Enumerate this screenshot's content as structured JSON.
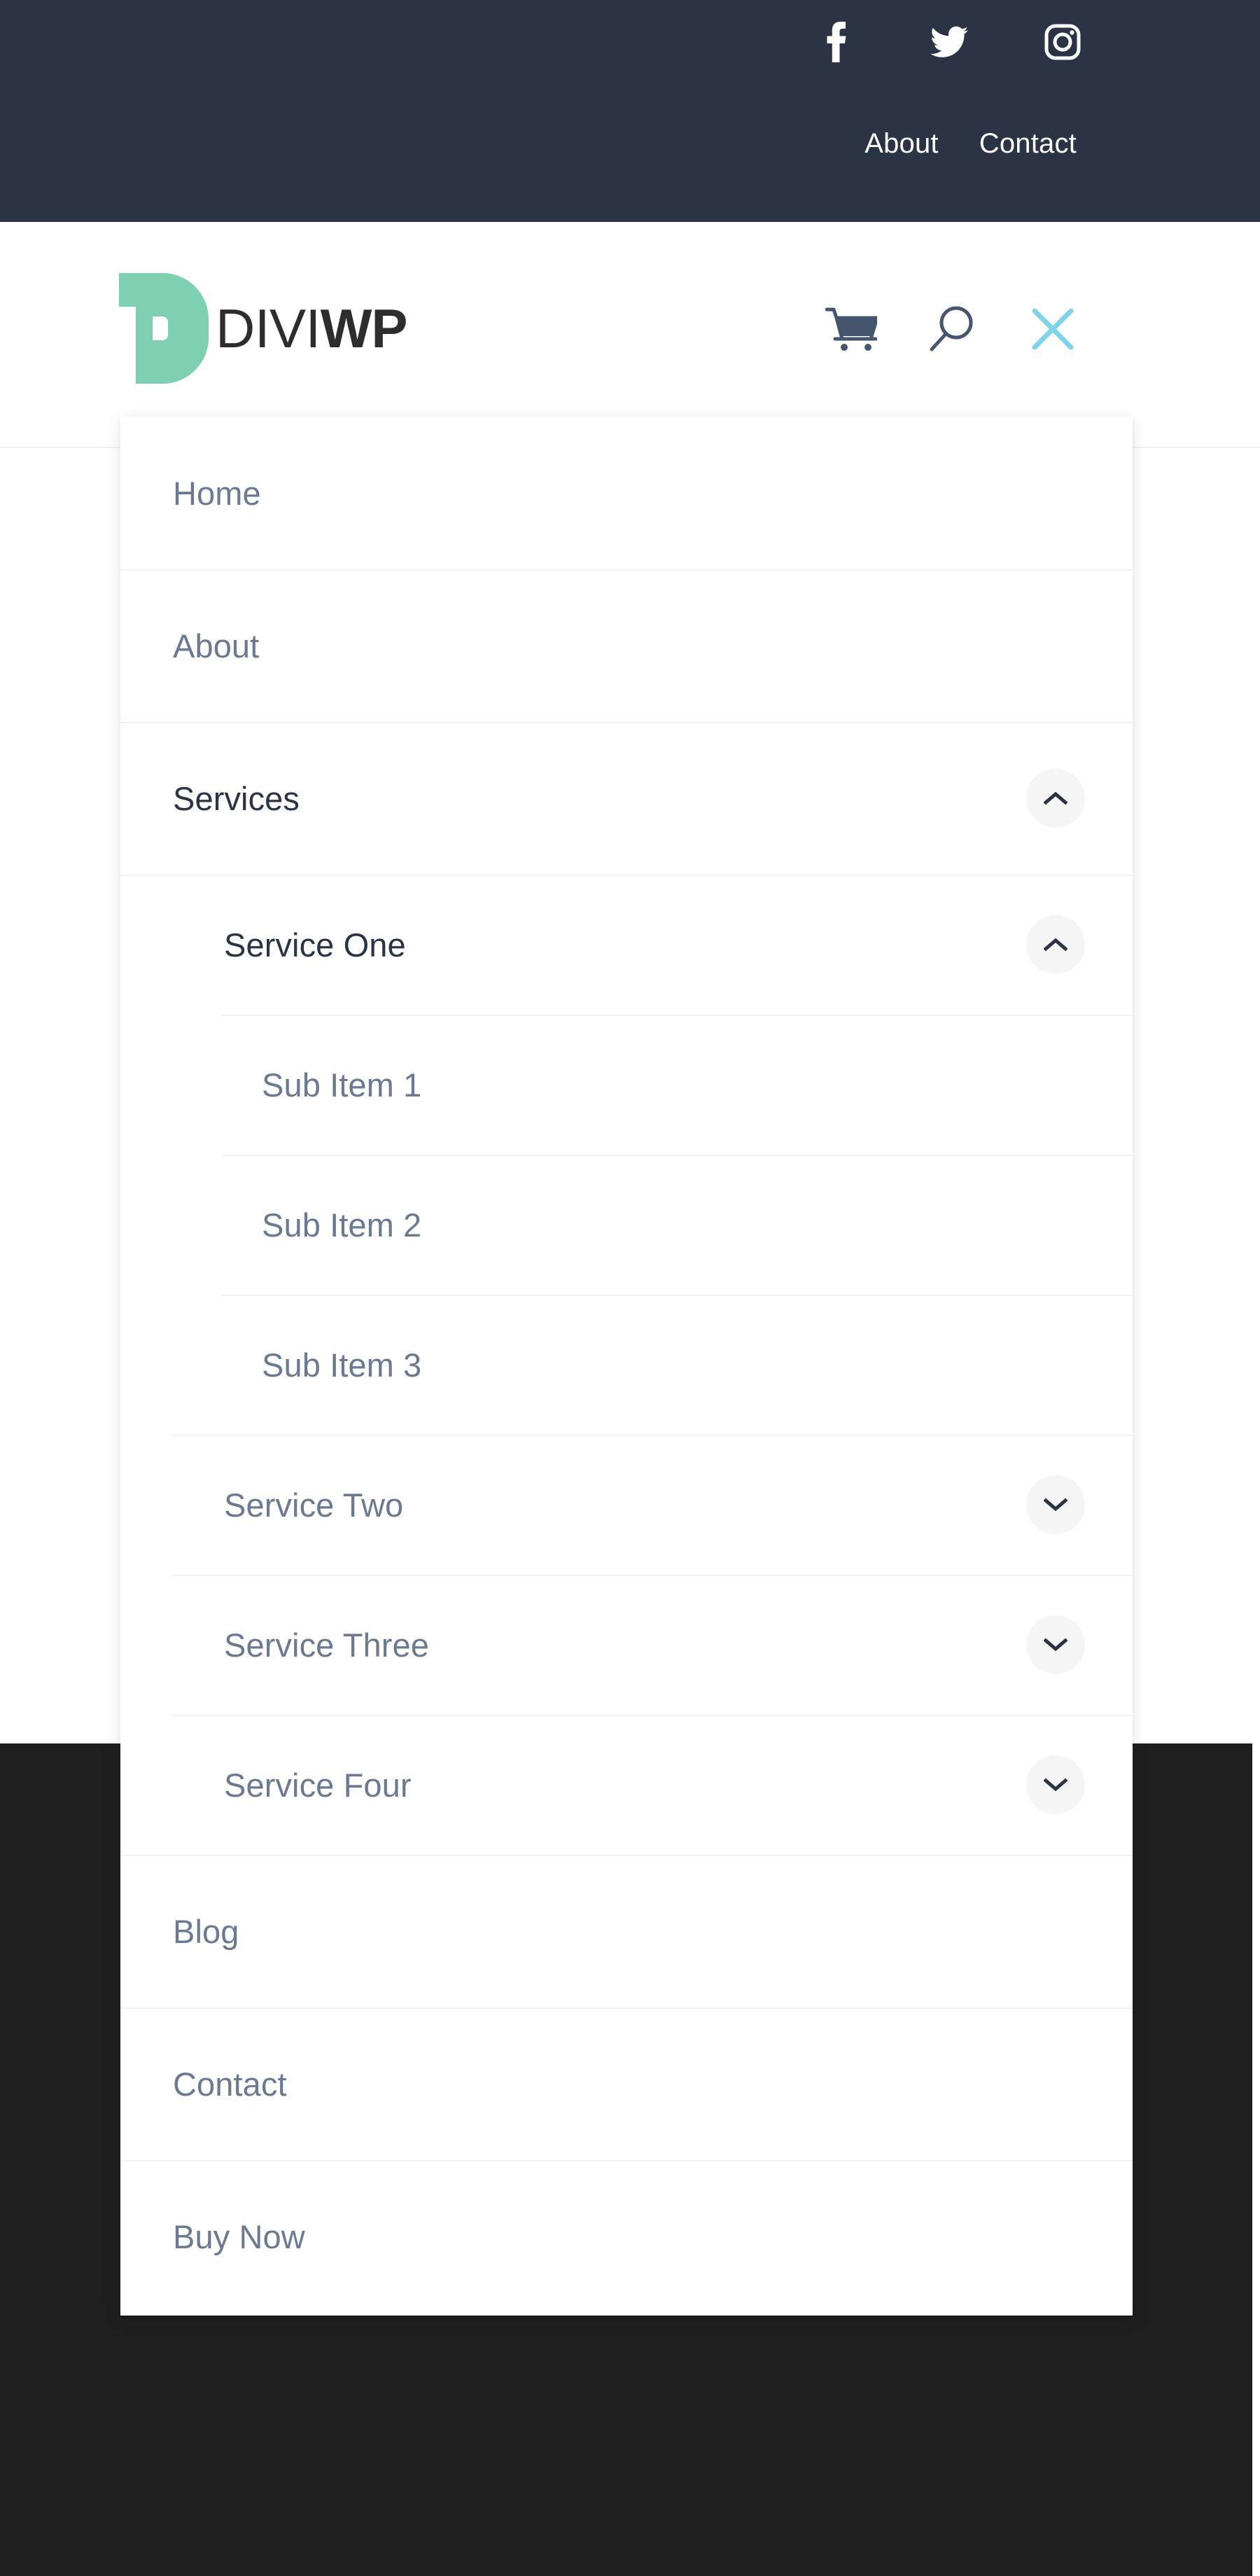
{
  "colors": {
    "topbar_bg": "#2b3445",
    "dark_section_bg": "#1f1f1f",
    "accent_green": "#7ed0b0",
    "close_icon": "#7fd4e8",
    "menu_text": "#6b7a91",
    "menu_text_active": "#2b3445",
    "divider": "#f1f2f4",
    "toggle_bg": "#f5f5f5"
  },
  "topbar": {
    "social": [
      {
        "name": "facebook-icon",
        "label": "Facebook"
      },
      {
        "name": "twitter-icon",
        "label": "Twitter"
      },
      {
        "name": "instagram-icon",
        "label": "Instagram"
      }
    ],
    "links": [
      {
        "label": "About"
      },
      {
        "label": "Contact"
      }
    ]
  },
  "header": {
    "logo": {
      "mark": "diviwp-d-mark",
      "text_thin": "DIVI",
      "text_bold": "WP"
    },
    "icons": [
      {
        "name": "cart-icon",
        "label": "Cart"
      },
      {
        "name": "search-icon",
        "label": "Search"
      },
      {
        "name": "close-icon",
        "label": "Close menu"
      }
    ]
  },
  "menu": {
    "items": [
      {
        "label": "Home",
        "level": 1,
        "active": false,
        "toggle": null,
        "divider": "none"
      },
      {
        "label": "About",
        "level": 1,
        "active": false,
        "toggle": null,
        "divider": "full"
      },
      {
        "label": "Services",
        "level": 1,
        "active": true,
        "toggle": "up",
        "divider": "full"
      },
      {
        "label": "Service One",
        "level": 2,
        "active": true,
        "toggle": "up",
        "divider": "full"
      },
      {
        "label": "Sub Item 1",
        "level": 3,
        "active": false,
        "toggle": null,
        "divider": "l2"
      },
      {
        "label": "Sub Item 2",
        "level": 3,
        "active": false,
        "toggle": null,
        "divider": "l2"
      },
      {
        "label": "Sub Item 3",
        "level": 3,
        "active": false,
        "toggle": null,
        "divider": "l2"
      },
      {
        "label": "Service Two",
        "level": 2,
        "active": false,
        "toggle": "down",
        "divider": "l1"
      },
      {
        "label": "Service Three",
        "level": 2,
        "active": false,
        "toggle": "down",
        "divider": "l1"
      },
      {
        "label": "Service Four",
        "level": 2,
        "active": false,
        "toggle": "down",
        "divider": "l1"
      },
      {
        "label": "Blog",
        "level": 1,
        "active": false,
        "toggle": null,
        "divider": "full"
      },
      {
        "label": "Contact",
        "level": 1,
        "active": false,
        "toggle": null,
        "divider": "full"
      },
      {
        "label": "Buy Now",
        "level": 1,
        "active": false,
        "toggle": null,
        "divider": "full"
      }
    ]
  }
}
